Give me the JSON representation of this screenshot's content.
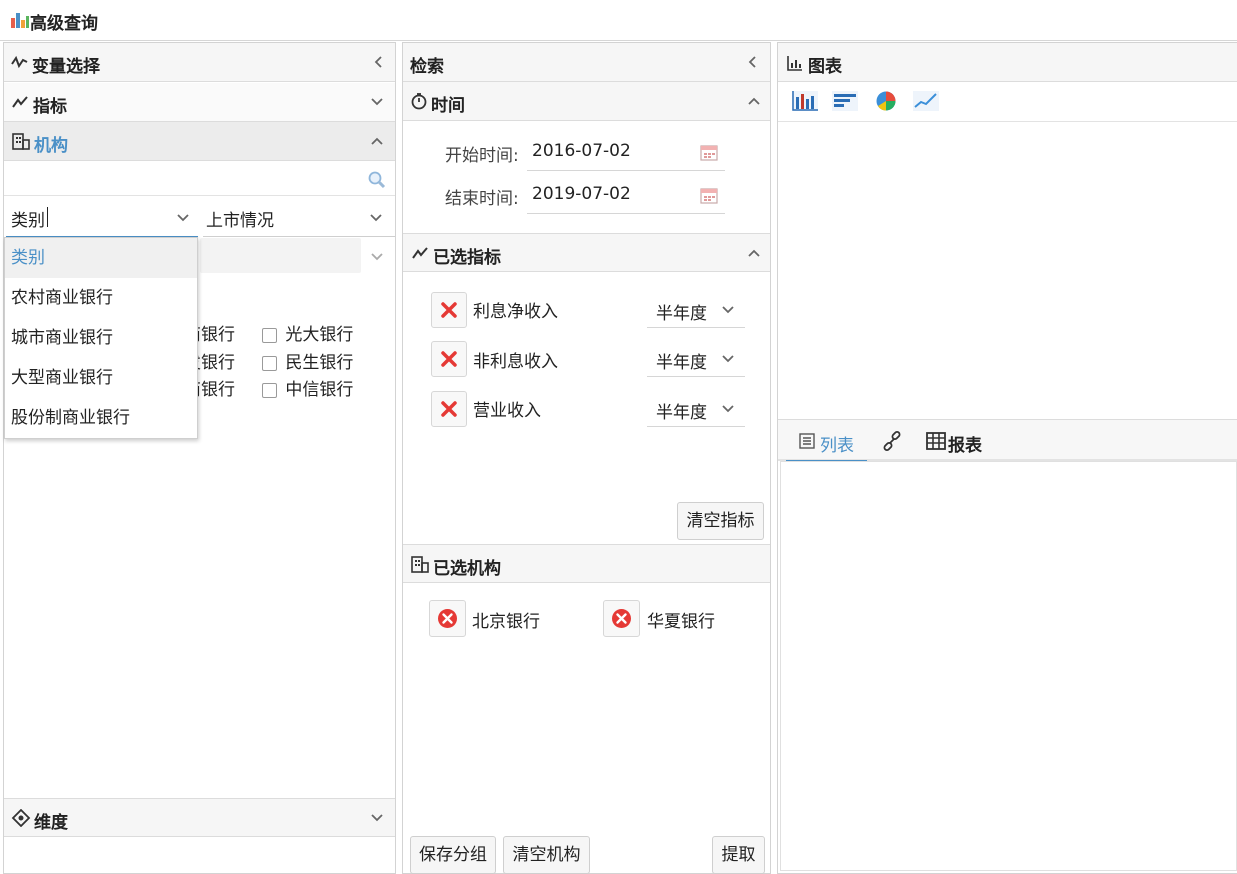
{
  "window": {
    "title": "高级查询",
    "icon": "chart-app-icon"
  },
  "variable_panel": {
    "title": "变量选择",
    "sections": {
      "indicator": {
        "label": "指标"
      },
      "institution": {
        "label": "机构"
      },
      "dimension": {
        "label": "维度"
      }
    },
    "search": {
      "placeholder": ""
    },
    "filter_category": {
      "value": "类别"
    },
    "filter_listing": {
      "value": "上市情况"
    },
    "dropdown_options": [
      "类别",
      "农村商业银行",
      "城市商业银行",
      "大型商业银行",
      "股份制商业银行"
    ],
    "checkbox_partial_left": [
      "商银行",
      "发银行",
      "商银行"
    ],
    "checkboxes_right": [
      "光大银行",
      "民生银行",
      "中信银行"
    ]
  },
  "search_panel": {
    "title": "检索",
    "time_section": {
      "label": "时间",
      "start_label": "开始时间:",
      "start_value": "2016-07-02",
      "end_label": "结束时间:",
      "end_value": "2019-07-02"
    },
    "selected_indicators": {
      "label": "已选指标",
      "items": [
        {
          "name": "利息净收入",
          "period": "半年度"
        },
        {
          "name": "非利息收入",
          "period": "半年度"
        },
        {
          "name": "营业收入",
          "period": "半年度"
        }
      ],
      "clear_button": "清空指标"
    },
    "selected_institutions": {
      "label": "已选机构",
      "items": [
        "北京银行",
        "华夏银行"
      ]
    },
    "footer": {
      "save_group": "保存分组",
      "clear_institutions": "清空机构",
      "extract": "提取"
    }
  },
  "chart_panel": {
    "title": "图表",
    "toolbar_icons": [
      "bar-chart-icon",
      "horizontal-bar-icon",
      "pie-chart-icon",
      "line-chart-icon"
    ],
    "tabs": {
      "list": "列表",
      "report": "报表"
    }
  },
  "colors": {
    "accent": "#4a90c7",
    "danger": "#e53935"
  }
}
